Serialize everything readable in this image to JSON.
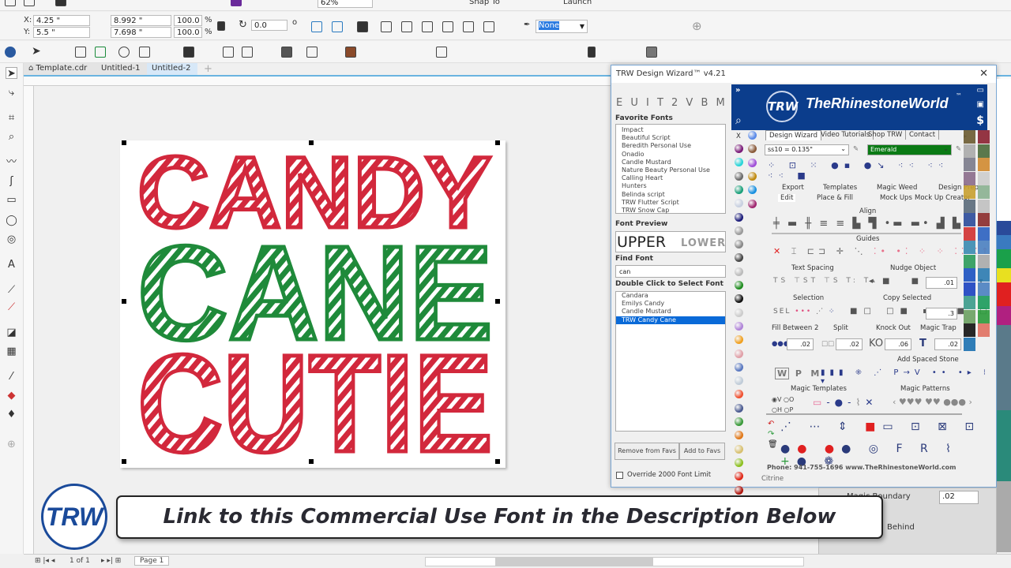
{
  "top_toolbar": {
    "zoom": "62%",
    "snap_to": "Snap To",
    "launch": "Launch"
  },
  "property_bar": {
    "x_label": "X:",
    "x": "4.25 \"",
    "y_label": "Y:",
    "y": "5.5 \"",
    "width": "8.992 \"",
    "height": "7.698 \"",
    "scale_w": "100.0",
    "scale_h": "100.0",
    "pct": "%",
    "rotation": "0.0",
    "degree": "o",
    "outline": "None"
  },
  "doc_tabs": [
    {
      "label": "Template.cdr"
    },
    {
      "label": "Untitled-1"
    },
    {
      "label": "Untitled-2"
    }
  ],
  "artwork": {
    "lines": [
      "CANDY",
      "CANE",
      "CUTIE"
    ],
    "colors": [
      "#d2283c",
      "#1f8a3a",
      "#d2283c"
    ]
  },
  "wizard": {
    "title": "TRW Design Wizard™ v4.21",
    "letters": "E U I T 2 V B M",
    "favorite_fonts_label": "Favorite Fonts",
    "favorite_fonts": [
      "Impact",
      "Beautiful Script",
      "Beredith Personal Use",
      "Onadio",
      "Candle Mustard",
      "Nature Beauty Personal Use",
      "Calling Heart",
      "Hunters",
      "Belinda script",
      "TRW Flutter Script",
      "TRW Snow Cap"
    ],
    "font_preview_label": "Font Preview",
    "preview_upper": "UPPER",
    "preview_lower": "LOWER",
    "find_font_label": "Find Font",
    "find_font_value": "can",
    "select_font_label": "Double Click to Select Font",
    "results": [
      "Candara",
      "Emilys Candy",
      "Candle Mustard",
      "TRW Candy Cane"
    ],
    "selected_result": "TRW Candy Cane",
    "remove_favs": "Remove from Favs",
    "add_favs": "Add to Favs",
    "override_label": "Override 2000 Font Limit",
    "brand": "TheRhinestoneWorld",
    "brand_logo": "TRW",
    "tm": "™",
    "top_tabs": [
      "Design Wizard",
      "Video Tutorials",
      "Shop TRW",
      "Contact"
    ],
    "stone_size": "ss10 = 0.135\"",
    "stone_color": "Emerald",
    "stone_color_hex": "#0a7a14",
    "row_tabs_1": [
      "Export",
      "Templates",
      "Magic Weed",
      "Design Prep"
    ],
    "row_tabs_2": [
      "Edit",
      "Place & Fill",
      "Mock Ups",
      "Mock Up Creator"
    ],
    "align": "Align",
    "guides": "Guides",
    "text_spacing": "Text Spacing",
    "nudge_object": "Nudge Object",
    "nudge_value": ".01",
    "selection": "Selection",
    "sel": "SEL",
    "copy_selected": "Copy Selected",
    "copy_value": ".3",
    "fill_between": "Fill Between 2",
    "split": "Split",
    "knock_out": "Knock Out",
    "magic_trap": "Magic Trap",
    "fill_value": ".02",
    "split_value": ".02",
    "ko": "KO",
    "ko_value": ".06",
    "trap_value": ".02",
    "add_spaced": "Add Spaced Stone",
    "wpm": [
      "W",
      "P",
      "M"
    ],
    "magic_templates": "Magic Templates",
    "magic_patterns": "Magic Patterns",
    "radios": [
      "V",
      "O",
      "H",
      "P"
    ],
    "phone": "Phone: 941-755-1696  www.TheRhinestoneWorld.com",
    "status": "Citrine",
    "dots_left": [
      "#7a1a78",
      "#2ad4d8",
      "#6a6a6a",
      "#1aa07a",
      "#c8d0e0",
      "#1c1c7a",
      "#9a9a9a",
      "#888",
      "#444",
      "#bbb",
      "#1e8c1e",
      "#111",
      "#ccc",
      "#b084d8",
      "#f0a020",
      "#e0a0a8",
      "#5a78c0",
      "#c0ccd8",
      "#f05030",
      "#4a5a90",
      "#3a9a3a",
      "#e07818",
      "#d8c070",
      "#8cc020",
      "#e02818",
      "#b01810"
    ],
    "dots_right": [
      "#5a8ae8",
      "#8a5a3a",
      "#a050d8",
      "#c08a10",
      "#1890e0",
      "#a02870"
    ],
    "glitter": [
      "#6a5a30",
      "#8a2030",
      "#aaa",
      "#4a6a3a",
      "#7a7a8a",
      "#d08a30",
      "#8a6a8a",
      "#ccc",
      "#c8a030",
      "#8ab090",
      "#5a6a7a",
      "#c0c0c0",
      "#2a4a9a",
      "#8a2a2a",
      "#d03030",
      "#2a60c0",
      "#3a8ab0",
      "#4a80c0",
      "#2a9a5a",
      "#aaa",
      "#1a50c0",
      "#2a7ab0",
      "#1a40c0",
      "#4a80c0",
      "#3a9a8a",
      "#1a9a5a",
      "#6aa060",
      "#2a9a3a",
      "#111",
      "#e07060",
      "#1a70b0"
    ]
  },
  "docker": {
    "magic_boundary": "Magic Boundary",
    "boundary_value": ".02",
    "behind": "Behind"
  },
  "banner": {
    "text": "Link to this Commercial Use Font in the Description Below",
    "logo": "TRW"
  },
  "status_bar": {
    "page_of": "1 of 1",
    "page_tab": "Page 1"
  }
}
